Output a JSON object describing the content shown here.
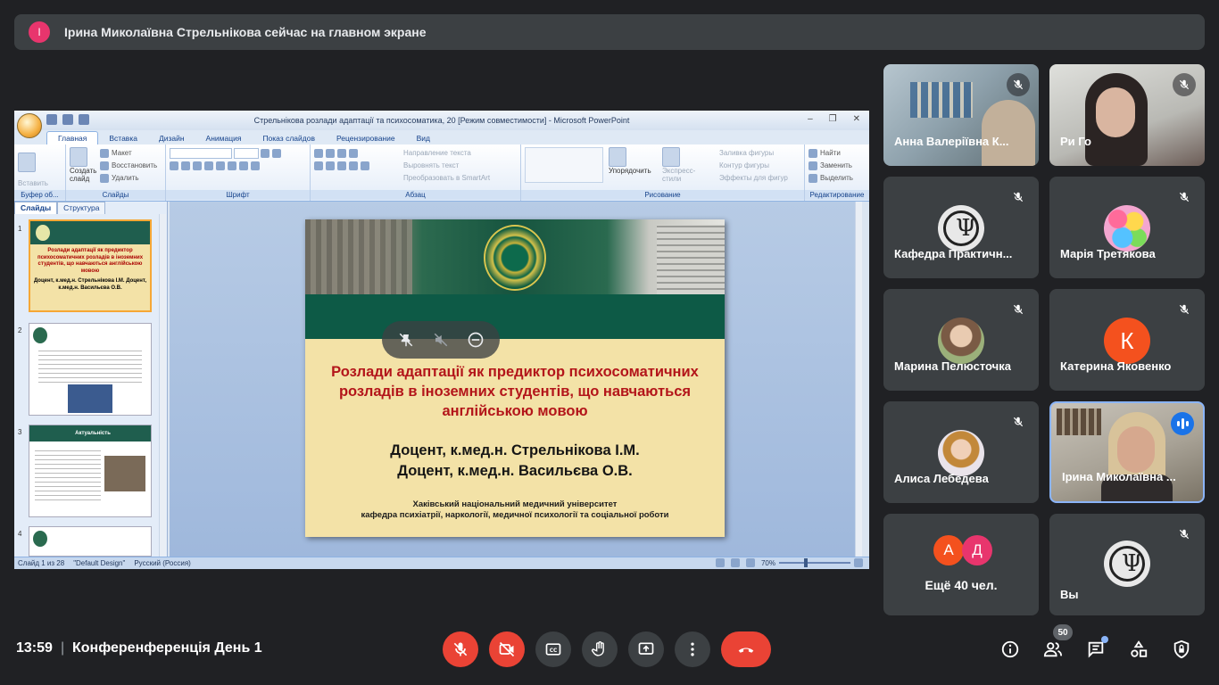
{
  "banner": {
    "initial": "I",
    "message": "Ірина Миколаївна Стрельнікова сейчас на главном экране"
  },
  "powerpoint": {
    "title": "Стрельнікова розлади адаптації та психосоматика, 20 [Режим совместимости] - Microsoft PowerPoint",
    "tabs": [
      "Главная",
      "Вставка",
      "Дизайн",
      "Анимация",
      "Показ слайдов",
      "Рецензирование",
      "Вид"
    ],
    "ribbon": {
      "clipboard": {
        "paste": "Вставить",
        "caption": "Буфер об..."
      },
      "slides": {
        "create": "Создать слайд",
        "layout": "Макет",
        "reset": "Восстановить",
        "delete": "Удалить",
        "caption": "Слайды"
      },
      "font": {
        "caption": "Шрифт"
      },
      "paragraph": {
        "direction": "Направление текста",
        "align": "Выровнять текст",
        "smartart": "Преобразовать в SmartArt",
        "caption": "Абзац"
      },
      "drawing": {
        "arrange": "Упорядочить",
        "quick_styles": "Экспресс-стили",
        "fill": "Заливка фигуры",
        "outline": "Контур фигуры",
        "effects": "Эффекты для фигур",
        "caption": "Рисование"
      },
      "editing": {
        "find": "Найти",
        "replace": "Заменить",
        "select": "Выделить",
        "caption": "Редактирование"
      }
    },
    "side_tabs": [
      "Слайды",
      "Структура"
    ],
    "thumbs": {
      "t1": {
        "num": "1",
        "title": "Розлади адаптації як предиктор психосоматичних розладів в іноземних студентів, що навчаються англійською мовою",
        "authors": "Доцент, к.мед.н. Стрельнікова І.М. Доцент, к.мед.н. Васильєва О.В."
      },
      "t2": {
        "num": "2"
      },
      "t3": {
        "num": "3",
        "header": "Актуальність"
      },
      "t4": {
        "num": "4"
      }
    },
    "slide": {
      "title": "Розлади адаптації як предиктор психосоматичних розладів в іноземних студентів, що навчаються англійською мовою",
      "author1": "Доцент, к.мед.н. Стрельнікова І.М.",
      "author2": "Доцент, к.мед.н. Васильєва О.В.",
      "uni1": "Хаківський національний медичний університет",
      "uni2": "кафедра психіатрії, наркології, медичної психології та соціальної роботи"
    },
    "status": {
      "slide": "Слайд 1 из 28",
      "design": "\"Default Design\"",
      "lang": "Русский (Россия)",
      "zoom": "70%"
    }
  },
  "participants": [
    {
      "name": "Анна Валеріївна К..."
    },
    {
      "name": "Ри Го"
    },
    {
      "name": "Кафедра Практичн..."
    },
    {
      "name": "Марія Третякова"
    },
    {
      "name": "Марина Пелюсточка"
    },
    {
      "name": "Катерина Яковенко",
      "initial": "К"
    },
    {
      "name": "Алиса Лебедева"
    },
    {
      "name": "Ірина Миколаївна ..."
    },
    {
      "name": "Ещё 40 чел.",
      "initials": [
        "А",
        "Д"
      ]
    },
    {
      "name": "Вы"
    }
  ],
  "bottom": {
    "time": "13:59",
    "separator": "|",
    "meeting": "Конференференція День 1",
    "people_count": "50"
  },
  "colors": {
    "accent": "#8ab4f8",
    "danger": "#ea4335",
    "surface": "#3c4043",
    "bg": "#202124"
  }
}
